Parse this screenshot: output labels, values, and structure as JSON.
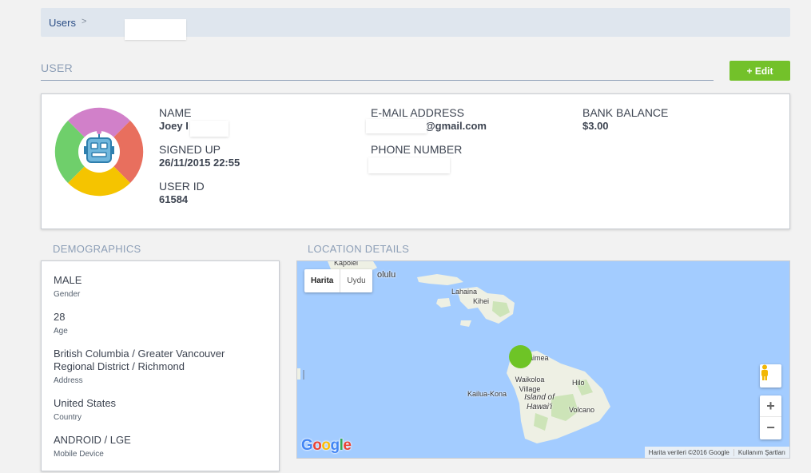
{
  "breadcrumb": {
    "root": "Users",
    "separator": ">"
  },
  "user_section": {
    "title": "USER",
    "edit_label": "+ Edit"
  },
  "profile": {
    "name_label": "NAME",
    "name_value": "Joey I",
    "email_label": "E-MAIL ADDRESS",
    "email_value": "@gmail.com",
    "bank_label": "BANK BALANCE",
    "bank_value": "$3.00",
    "signed_label": "SIGNED UP",
    "signed_value": "26/11/2015 22:55",
    "phone_label": "PHONE NUMBER",
    "userid_label": "USER ID",
    "userid_value": "61584"
  },
  "demographics": {
    "title": "DEMOGRAPHICS",
    "items": [
      {
        "value": "MALE",
        "key": "Gender"
      },
      {
        "value": "28",
        "key": "Age"
      },
      {
        "value": "British Columbia / Greater Vancouver Regional District / Richmond",
        "key": "Address"
      },
      {
        "value": "United States",
        "key": "Country"
      },
      {
        "value": "ANDROID / LGE",
        "key": "Mobile Device"
      }
    ]
  },
  "location": {
    "title": "LOCATION DETAILS",
    "map_type": {
      "map": "Harita",
      "satellite": "Uydu"
    },
    "places": {
      "kapolei": "Kapolei",
      "honolulu": "olulu",
      "lahaina": "Lahaina",
      "kihei": "Kihei",
      "kamuela": "aimea",
      "waikoloa": "Waikoloa Village",
      "kailua": "Kailua-Kona",
      "island": "Island of Hawai'i",
      "hilo": "Hilo",
      "volcano": "Volcano"
    },
    "google": "Google",
    "attribution": "Harita verileri ©2016 Google",
    "terms": "Kullanım Şartları",
    "zoom_in": "+",
    "zoom_out": "−",
    "marker_color": "#6ec426"
  }
}
